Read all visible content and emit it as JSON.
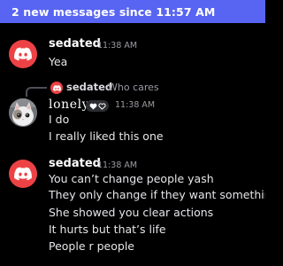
{
  "banner": {
    "text": "2 new messages since 11:57 AM"
  },
  "messages": [
    {
      "username": "sedated",
      "timestamp": "11:38 AM",
      "avatar": "discord-logo-icon",
      "lines": [
        "Yea"
      ]
    },
    {
      "reply_to": {
        "username": "sedated",
        "text": "Who cares",
        "avatar": "discord-logo-icon"
      },
      "username": "lonely",
      "badges": [
        "heart-icon",
        "heart-outline-icon"
      ],
      "timestamp": "11:38 AM",
      "avatar": "cat-photo-avatar",
      "lines": [
        "I do",
        "I really liked this one"
      ]
    },
    {
      "username": "sedated",
      "timestamp": "11:38 AM",
      "avatar": "discord-logo-icon",
      "lines": [
        "You can’t change people yash",
        "They only change if they want something",
        "She showed you clear actions",
        "It hurts but that’s life",
        "People r people"
      ]
    }
  ],
  "colors": {
    "background": "#000000",
    "banner": "#5865f2",
    "discord_avatar": "#ed4245",
    "text": "#e6e6ea",
    "muted": "#9b9ba3"
  }
}
